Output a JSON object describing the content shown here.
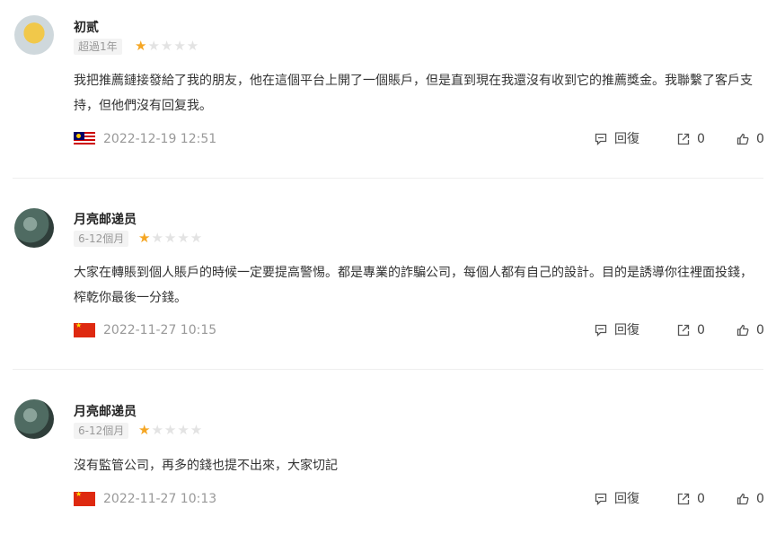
{
  "reviews": [
    {
      "author": "初贰",
      "tenure": "超過1年",
      "rating": 1,
      "text": "我把推薦鏈接發給了我的朋友，他在這個平台上開了一個賬戶，但是直到現在我還沒有收到它的推薦獎金。我聯繫了客戶支持，但他們沒有回复我。",
      "country_flag": "malaysia-flag-icon",
      "datetime": "2022-12-19 12:51",
      "reply_label": "回復",
      "share_count": "0",
      "like_count": "0"
    },
    {
      "author": "月亮邮递员",
      "tenure": "6-12個月",
      "rating": 1,
      "text": "大家在轉賬到個人賬戶的時候一定要提高警惕。都是專業的詐騙公司，每個人都有自己的設計。目的是誘導你往裡面投錢，榨乾你最後一分錢。",
      "country_flag": "china-flag-icon",
      "datetime": "2022-11-27 10:15",
      "reply_label": "回復",
      "share_count": "0",
      "like_count": "0"
    },
    {
      "author": "月亮邮递员",
      "tenure": "6-12個月",
      "rating": 1,
      "text": "沒有監管公司，再多的錢也提不出來，大家切記",
      "country_flag": "china-flag-icon",
      "datetime": "2022-11-27 10:13",
      "reply_label": "回復",
      "share_count": "0",
      "like_count": "0"
    }
  ],
  "colors": {
    "star_on": "#f5a623",
    "star_off": "#e3e3e3",
    "meta_text": "#999999",
    "divider": "#eeeeee"
  },
  "icons": {
    "reply": "comment-icon",
    "share": "share-icon",
    "like": "thumbs-up-icon"
  }
}
